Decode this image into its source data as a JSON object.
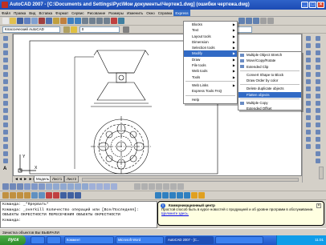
{
  "window": {
    "title": "AutoCAD 2007 - [C:\\Documents and Settings\\Рус\\Мои документы\\Чертеж1.dwg] (ошибки чертежа.dwg)"
  },
  "menubar": [
    "Файл",
    "Правка",
    "Вид",
    "Вставка",
    "Формат",
    "Сервис",
    "Рисование",
    "Размеры",
    "Изменить",
    "Окно",
    "Справка",
    "Express"
  ],
  "toolbar": {
    "workspace": "Классический AutoCAD",
    "layer": "0",
    "linetype": "ПоСлою"
  },
  "express_menu": {
    "items": [
      {
        "label": "Blocks",
        "submenu": true
      },
      {
        "label": "Text",
        "submenu": true
      },
      {
        "label": "Layout tools",
        "submenu": true
      },
      {
        "label": "Dimension",
        "submenu": true
      },
      {
        "label": "Selection tools",
        "submenu": true
      },
      {
        "label": "Modify",
        "submenu": true,
        "highlighted": true
      },
      {
        "label": "Draw",
        "submenu": true
      },
      {
        "label": "File tools",
        "submenu": true
      },
      {
        "label": "Web tools",
        "submenu": true
      },
      {
        "label": "Tools",
        "submenu": true
      },
      {
        "label": "Web Links",
        "submenu": true
      },
      {
        "label": "Express Tools FAQ",
        "submenu": false
      },
      {
        "label": "Help",
        "submenu": false
      }
    ]
  },
  "modify_submenu": {
    "items": [
      {
        "label": "Multiple Object Stretch"
      },
      {
        "label": "Move/Copy/Rotate"
      },
      {
        "label": "Extended Clip"
      },
      {
        "label": "Convert Shape to Block"
      },
      {
        "label": "Draw Order by color"
      },
      {
        "label": "Delete duplicate objects"
      },
      {
        "label": "Flatten objects",
        "highlighted": true
      },
      {
        "label": "Multiple Copy"
      },
      {
        "label": "Extended Offset"
      }
    ]
  },
  "layout_tabs": [
    "Модель",
    "Лист1",
    "Лист2"
  ],
  "command_line": {
    "lines": [
      "Команда: _*Прервать*",
      "Команда: _overkill Количество операций или [Все/Последняя]:",
      "ОБЪЕКТЫ ОКРЕСТНОСТИ ПЕРЕСЕЧЕНИЯ ОБЪЕКТЫ ОКРЕСТНОСТИ",
      "Команда:"
    ],
    "status": "Зачистка объектов ВЫ ВЫБРАЛИ"
  },
  "balloon": {
    "title": "Коммуникационный центр",
    "text": "Простой способ быть в курсе новостей с продукцией и об уровне программ в обслуживании.",
    "link": "Щелкните здесь."
  },
  "taskbar": {
    "start": "пуск",
    "buttons": [
      "",
      "",
      "Коммент",
      "Microsoft Word",
      "AutoCAD 2007 - [C...",
      ""
    ],
    "clock": "11:01"
  },
  "colors": {
    "titlebar": "#1c4bb4",
    "menu_highlight": "#316ac5",
    "balloon_bg": "#ffffe1",
    "start_green": "#2c8a28"
  }
}
